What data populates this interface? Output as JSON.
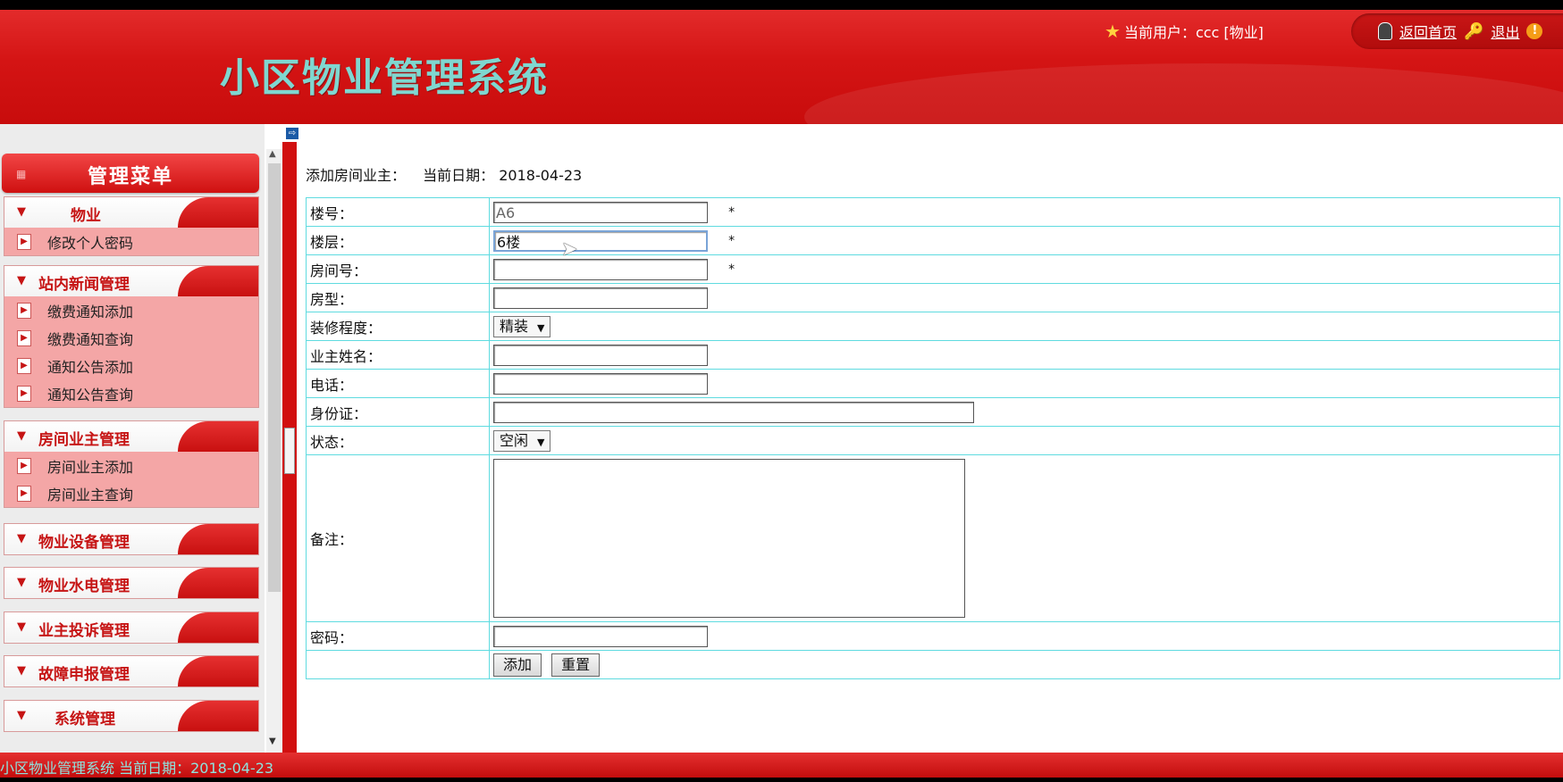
{
  "header": {
    "system_title": "小区物业管理系统",
    "current_user_label": "当前用户：ccc [物业]",
    "home_link": "返回首页",
    "logout_link": "退出"
  },
  "sidebar": {
    "menu_title": "管理菜单",
    "groups": [
      {
        "label": "物业",
        "items": [
          "修改个人密码"
        ]
      },
      {
        "label": "站内新闻管理",
        "items": [
          "缴费通知添加",
          "缴费通知查询",
          "通知公告添加",
          "通知公告查询"
        ]
      },
      {
        "label": "房间业主管理",
        "items": [
          "房间业主添加",
          "房间业主查询"
        ]
      },
      {
        "label": "物业设备管理",
        "items": []
      },
      {
        "label": "物业水电管理",
        "items": []
      },
      {
        "label": "业主投诉管理",
        "items": []
      },
      {
        "label": "故障申报管理",
        "items": []
      },
      {
        "label": "系统管理",
        "items": []
      }
    ]
  },
  "content": {
    "heading": "添加房间业主：",
    "date_label": "当前日期：",
    "date_value": "2018-04-23",
    "required_mark": "*",
    "fields": {
      "building": {
        "label": "楼号：",
        "value": "A6"
      },
      "floor": {
        "label": "楼层：",
        "value": "6楼"
      },
      "room": {
        "label": "房间号：",
        "value": ""
      },
      "room_type": {
        "label": "房型：",
        "value": ""
      },
      "decoration": {
        "label": "装修程度：",
        "selected": "精装"
      },
      "owner_name": {
        "label": "业主姓名：",
        "value": ""
      },
      "phone": {
        "label": "电话：",
        "value": ""
      },
      "id_card": {
        "label": "身份证：",
        "value": ""
      },
      "status": {
        "label": "状态：",
        "selected": "空闲"
      },
      "remarks": {
        "label": "备注：",
        "value": ""
      },
      "password": {
        "label": "密码：",
        "value": ""
      }
    },
    "buttons": {
      "add": "添加",
      "reset": "重置"
    }
  },
  "footer": {
    "system_title": "小区物业管理系统",
    "date_label": "当前日期：",
    "date_value": "2018-04-23"
  },
  "colors": {
    "brand_red": "#d41414",
    "accent_cyan": "#5fdbe0",
    "title_teal": "#7fd7d0",
    "menu_pink": "#f4a6a6"
  }
}
